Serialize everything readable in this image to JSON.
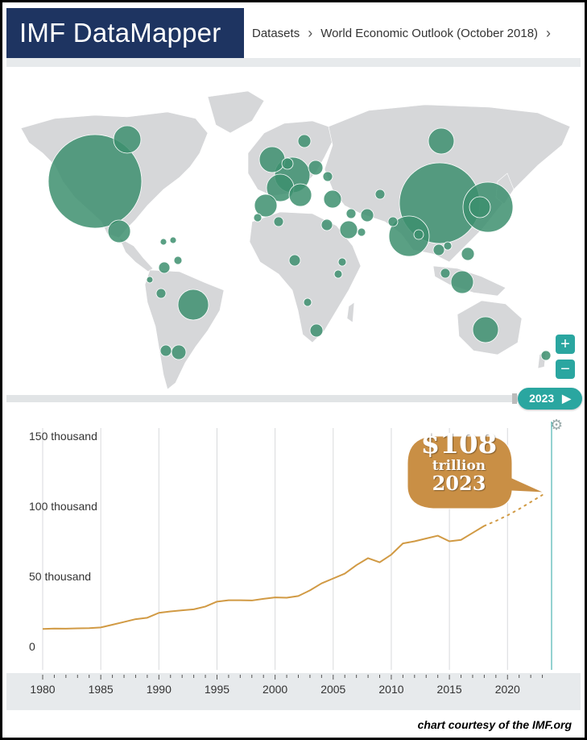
{
  "header": {
    "brand": "IMF DataMapper",
    "breadcrumbs": [
      "Datasets",
      "World Economic Outlook (October 2018)"
    ]
  },
  "map": {
    "zoom_in": "+",
    "zoom_out": "−"
  },
  "year_selector": {
    "label": "2023",
    "play_icon": "play-icon"
  },
  "callout": {
    "amount": "$108",
    "unit": "trillion",
    "year": "2023"
  },
  "credit": "chart courtesy of the IMF.org",
  "colors": {
    "brand_bg": "#1e3461",
    "accent": "#2aa6a0",
    "bubble": "#3d8f6e",
    "line": "#d19a44",
    "callout": "#c98f45",
    "land": "#d6d7d9"
  },
  "chart_data": {
    "type": "line",
    "y_ticks": [
      {
        "value": 0,
        "label": "0"
      },
      {
        "value": 50000,
        "label": "50 thousand"
      },
      {
        "value": 100000,
        "label": "100 thousand"
      },
      {
        "value": 150000,
        "label": "150 thousand"
      }
    ],
    "x_ticks": [
      1980,
      1985,
      1990,
      1995,
      2000,
      2005,
      2010,
      2015,
      2020
    ],
    "xlim": [
      1980,
      2024
    ],
    "ylim": [
      0,
      150000
    ],
    "grid": true,
    "series": [
      {
        "style": "solid",
        "x": [
          1980,
          1981,
          1982,
          1983,
          1984,
          1985,
          1986,
          1987,
          1988,
          1989,
          1990,
          1991,
          1992,
          1993,
          1994,
          1995,
          1996,
          1997,
          1998,
          1999,
          2000,
          2001,
          2002,
          2003,
          2004,
          2005,
          2006,
          2007,
          2008,
          2009,
          2010,
          2011,
          2012,
          2013,
          2014,
          2015,
          2016,
          2017,
          2018
        ],
        "y": [
          12500,
          12800,
          12700,
          12900,
          13100,
          13600,
          15500,
          17500,
          19500,
          20500,
          24000,
          25000,
          25800,
          26500,
          28500,
          32000,
          33000,
          33000,
          32800,
          34000,
          35000,
          34800,
          36000,
          40000,
          45000,
          48500,
          52000,
          58000,
          63000,
          60000,
          65500,
          73500,
          75000,
          77000,
          79000,
          75000,
          76000,
          81000,
          86000
        ]
      },
      {
        "style": "dotted",
        "x": [
          2018,
          2019,
          2020,
          2021,
          2022,
          2023
        ],
        "y": [
          86000,
          89500,
          93500,
          98000,
          103000,
          108000
        ]
      }
    ]
  }
}
